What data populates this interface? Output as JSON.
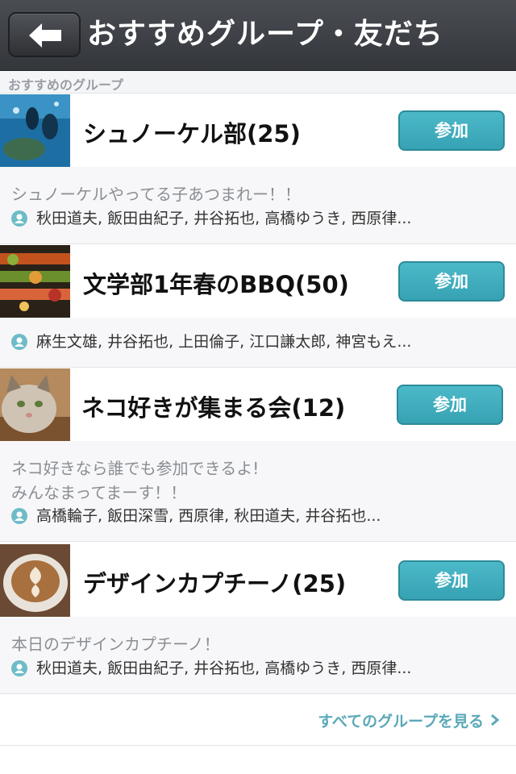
{
  "nav": {
    "title": "おすすめグループ・友だち"
  },
  "section": {
    "title": "おすすめのグループ"
  },
  "join_label": "参加",
  "groups": [
    {
      "name": "シュノーケル部(25)",
      "description": "シュノーケルやってる子あつまれー！！",
      "description2": "",
      "members": "秋田道夫, 飯田由紀子, 井谷拓也, 高橋ゆうき, 西原律..."
    },
    {
      "name": "文学部1年春のBBQ(50)",
      "description": "",
      "description2": "",
      "members": "麻生文雄, 井谷拓也, 上田倫子, 江口謙太郎, 神宮もえ..."
    },
    {
      "name": "ネコ好きが集まる会(12)",
      "description": "ネコ好きなら誰でも参加できるよ!",
      "description2": "みんなまってまーす！！",
      "members": "高橋輪子, 飯田深雪, 西原律, 秋田道夫, 井谷拓也..."
    },
    {
      "name": "デザインカプチーノ(25)",
      "description": "本日のデザインカプチーノ！",
      "description2": "",
      "members": "秋田道夫, 飯田由紀子, 井谷拓也, 高橋ゆうき, 西原律..."
    }
  ],
  "footer": {
    "see_all": "すべてのグループを見る"
  },
  "colors": {
    "accent": "#3aa7b8",
    "navbar": "#3b3e43",
    "member_icon": "#6fbcc8"
  }
}
